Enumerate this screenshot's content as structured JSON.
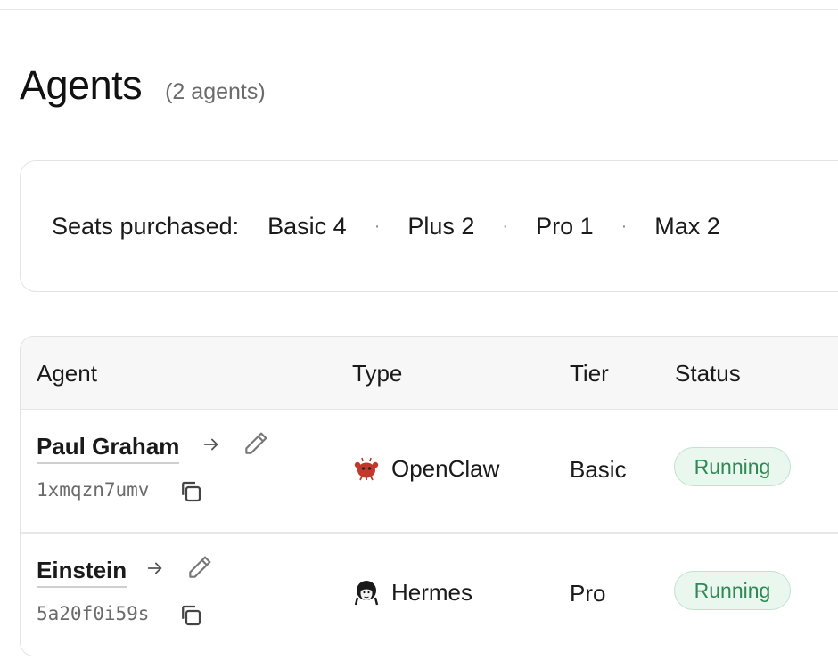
{
  "page": {
    "title": "Agents",
    "count_label": "(2 agents)"
  },
  "seats": {
    "label": "Seats purchased:",
    "separator": "·",
    "items": [
      {
        "text": "Basic 4"
      },
      {
        "text": "Plus 2"
      },
      {
        "text": "Pro 1"
      },
      {
        "text": "Max 2"
      }
    ]
  },
  "table": {
    "headers": {
      "agent": "Agent",
      "type": "Type",
      "tier": "Tier",
      "status": "Status"
    },
    "rows": [
      {
        "name": "Paul Graham",
        "id": "1xmqzn7umv",
        "type": "OpenClaw",
        "type_icon": "openclaw-icon",
        "tier": "Basic",
        "status": "Running"
      },
      {
        "name": "Einstein",
        "id": "5a20f0i59s",
        "type": "Hermes",
        "type_icon": "hermes-icon",
        "tier": "Pro",
        "status": "Running"
      }
    ]
  },
  "colors": {
    "status_running_text": "#2f8a55",
    "status_running_bg": "#eaf7ef",
    "status_running_border": "#bfe3cf",
    "openclaw_icon": "#c0392b"
  }
}
